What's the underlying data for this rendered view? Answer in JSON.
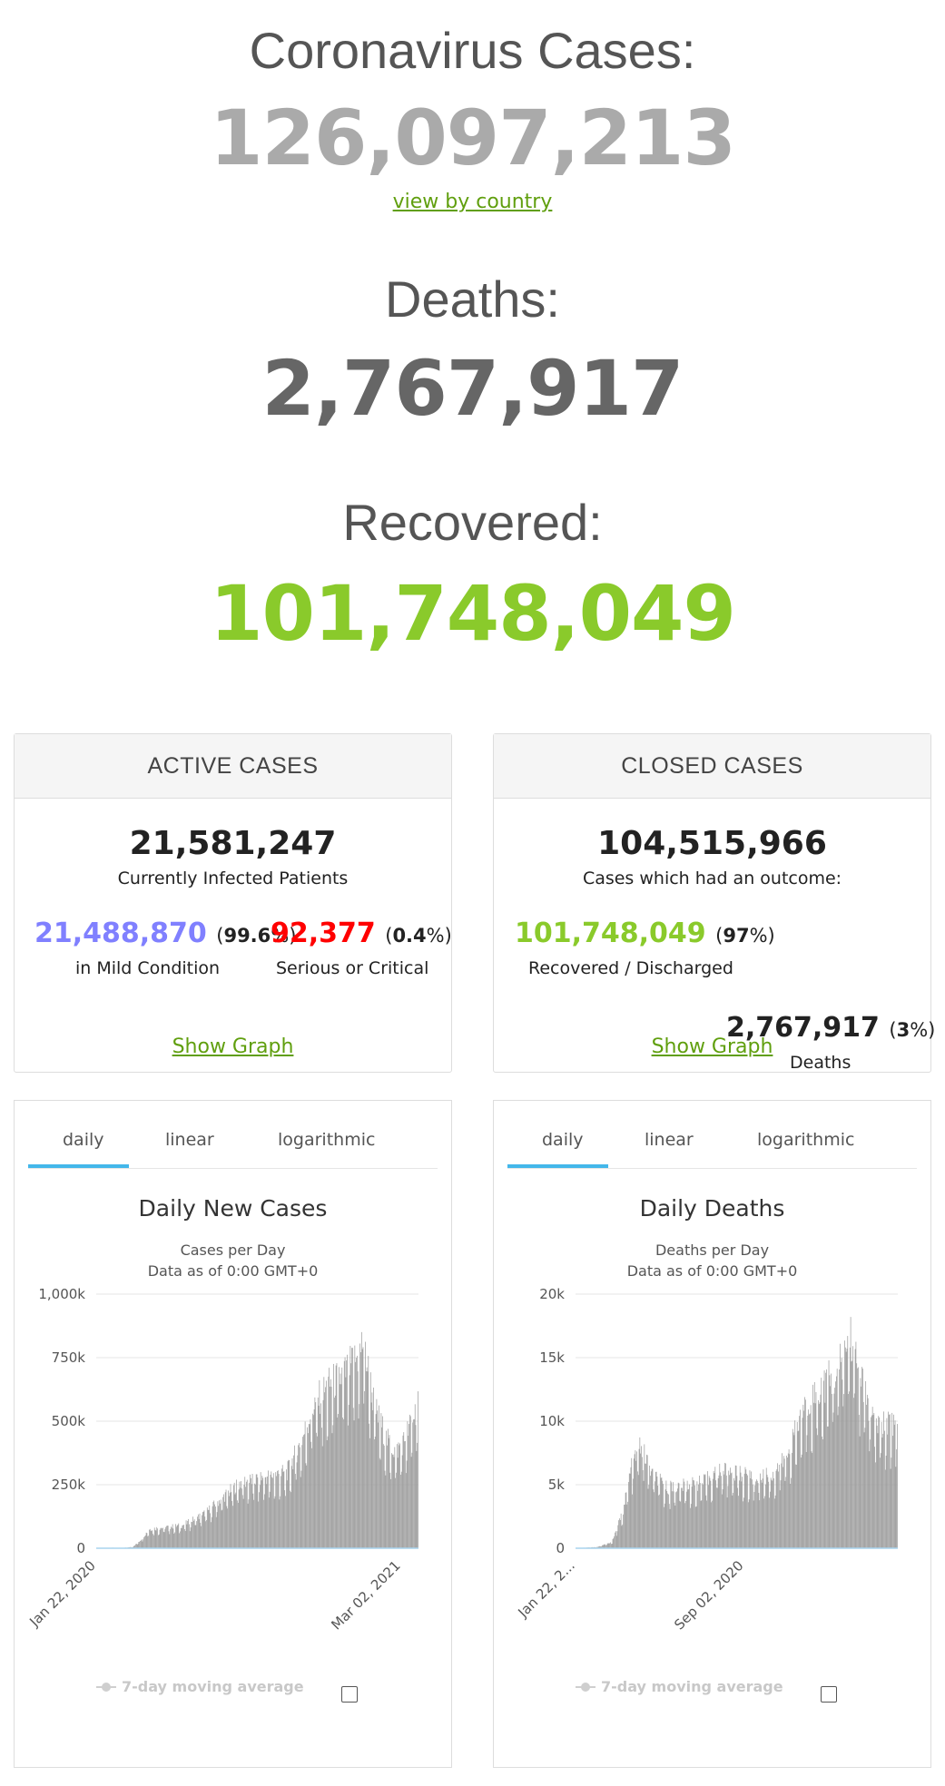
{
  "header": {
    "cases_label": "Coronavirus Cases:",
    "cases_value": "126,097,213",
    "view_link": "view by country",
    "deaths_label": "Deaths:",
    "deaths_value": "2,767,917",
    "recovered_label": "Recovered:",
    "recovered_value": "101,748,049"
  },
  "active": {
    "title": "ACTIVE CASES",
    "total": "21,581,247",
    "total_label": "Currently Infected Patients",
    "mild_value": "21,488,870",
    "mild_pct_open": "(",
    "mild_pct": "99.6",
    "mild_pct_close": "%)",
    "mild_label": "in Mild Condition",
    "serious_value": "92,377",
    "serious_pct_open": "(",
    "serious_pct": "0.4",
    "serious_pct_close": "%)",
    "serious_label": "Serious or Critical",
    "show_graph": "Show Graph"
  },
  "closed": {
    "title": "CLOSED CASES",
    "total": "104,515,966",
    "total_label": "Cases which had an outcome:",
    "recovered_value": "101,748,049",
    "recovered_pct_open": "(",
    "recovered_pct": "97",
    "recovered_pct_close": "%)",
    "recovered_label": "Recovered / Discharged",
    "deaths_value": "2,767,917",
    "deaths_pct_open": "(",
    "deaths_pct": "3",
    "deaths_pct_close": "%)",
    "deaths_label": "Deaths",
    "show_graph": "Show Graph"
  },
  "colors": {
    "cases": "#aaaaaa",
    "deaths": "#666666",
    "recovered": "#8ACA2B",
    "mild": "#8080FF",
    "serious": "#FF0000",
    "link": "#609f0e",
    "tab_active": "#43b7ea",
    "bars": "#999999"
  },
  "tabs": [
    "daily",
    "linear",
    "logarithmic"
  ],
  "legend": {
    "label": "7-day moving average"
  },
  "chart_data": [
    {
      "type": "bar",
      "title": "Daily New Cases",
      "subtitle": "Cases per Day",
      "subtitle2": "Data as of 0:00 GMT+0",
      "ylim": [
        0,
        1000000
      ],
      "yticks": [
        "1,000k",
        "750k",
        "500k",
        "250k",
        "0"
      ],
      "ytick_values": [
        1000000,
        750000,
        500000,
        250000,
        0
      ],
      "xticks": [
        "Jan 22, 2020",
        "Mar 02, 2021"
      ],
      "x_start": "Jan 22, 2020",
      "x_end": "Mar 24, 2021",
      "grid": true,
      "legend": "bottom",
      "checkpoints": [
        [
          "2020-01-22",
          0
        ],
        [
          "2020-02-12",
          2000
        ],
        [
          "2020-02-27",
          1500
        ],
        [
          "2020-03-10",
          5000
        ],
        [
          "2020-03-20",
          30000
        ],
        [
          "2020-04-01",
          75000
        ],
        [
          "2020-04-15",
          80000
        ],
        [
          "2020-05-15",
          90000
        ],
        [
          "2020-06-15",
          140000
        ],
        [
          "2020-07-15",
          220000
        ],
        [
          "2020-08-01",
          260000
        ],
        [
          "2020-08-20",
          270000
        ],
        [
          "2020-09-15",
          290000
        ],
        [
          "2020-10-01",
          300000
        ],
        [
          "2020-10-20",
          420000
        ],
        [
          "2020-11-05",
          560000
        ],
        [
          "2020-11-25",
          640000
        ],
        [
          "2020-12-15",
          680000
        ],
        [
          "2021-01-05",
          760000
        ],
        [
          "2021-01-10",
          820000
        ],
        [
          "2021-01-25",
          560000
        ],
        [
          "2021-02-10",
          430000
        ],
        [
          "2021-02-22",
          380000
        ],
        [
          "2021-03-05",
          420000
        ],
        [
          "2021-03-18",
          520000
        ],
        [
          "2021-03-24",
          570000
        ]
      ]
    },
    {
      "type": "bar",
      "title": "Daily Deaths",
      "subtitle": "Deaths per Day",
      "subtitle2": "Data as of 0:00 GMT+0",
      "ylim": [
        0,
        20000
      ],
      "yticks": [
        "20k",
        "15k",
        "10k",
        "5k",
        "0"
      ],
      "ytick_values": [
        20000,
        15000,
        10000,
        5000,
        0
      ],
      "xticks": [
        "Jan 22, 2...",
        "Sep 02, 2020"
      ],
      "x_start": "Jan 22, 2020",
      "x_end": "Mar 24, 2021",
      "grid": true,
      "legend": "bottom",
      "checkpoints": [
        [
          "2020-01-22",
          0
        ],
        [
          "2020-02-20",
          100
        ],
        [
          "2020-03-10",
          500
        ],
        [
          "2020-03-25",
          3000
        ],
        [
          "2020-04-05",
          6500
        ],
        [
          "2020-04-17",
          8200
        ],
        [
          "2020-05-01",
          6000
        ],
        [
          "2020-05-20",
          4800
        ],
        [
          "2020-06-15",
          4900
        ],
        [
          "2020-07-10",
          5200
        ],
        [
          "2020-08-01",
          6200
        ],
        [
          "2020-08-20",
          6000
        ],
        [
          "2020-09-15",
          5500
        ],
        [
          "2020-10-10",
          5800
        ],
        [
          "2020-10-30",
          7500
        ],
        [
          "2020-11-20",
          11000
        ],
        [
          "2020-12-10",
          12500
        ],
        [
          "2021-01-05",
          14000
        ],
        [
          "2021-01-20",
          17000
        ],
        [
          "2021-02-05",
          13000
        ],
        [
          "2021-02-20",
          10000
        ],
        [
          "2021-03-10",
          9500
        ],
        [
          "2021-03-24",
          10200
        ]
      ]
    }
  ]
}
